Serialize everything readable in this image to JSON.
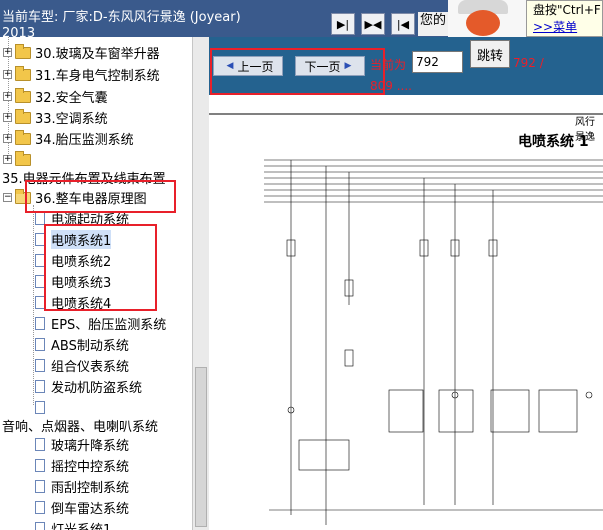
{
  "header": {
    "title_line1": "当前车型:   厂家:D-东风风行景逸 (Joyear)",
    "title_line2": "2013",
    "toolbar_text": "您的",
    "help_line1": "盘按\"Ctrl+F",
    "help_line2": ">>菜单"
  },
  "tree": {
    "items": [
      {
        "label": "30.玻璃及车窗举升器"
      },
      {
        "label": "31.车身电气控制系统"
      },
      {
        "label": "32.安全气囊"
      },
      {
        "label": "33.空调系统"
      },
      {
        "label": "34.胎压监测系统"
      },
      {
        "label": ""
      },
      {
        "label": "35.电器元件布置及线束布置"
      },
      {
        "label": "36.整车电器原理图"
      },
      {
        "label": "电源起动系统"
      },
      {
        "label": "电喷系统1"
      },
      {
        "label": "电喷系统2"
      },
      {
        "label": "电喷系统3"
      },
      {
        "label": "电喷系统4"
      },
      {
        "label": "EPS、胎压监测系统"
      },
      {
        "label": "ABS制动系统"
      },
      {
        "label": "组合仪表系统"
      },
      {
        "label": "发动机防盗系统"
      },
      {
        "label": ""
      },
      {
        "label": "音响、点烟器、电喇叭系统"
      },
      {
        "label": "玻璃升降系统"
      },
      {
        "label": "摇控中控系统"
      },
      {
        "label": "雨刮控制系统"
      },
      {
        "label": "倒车雷达系统"
      },
      {
        "label": "灯光系统1"
      }
    ]
  },
  "nav": {
    "prev_label": "上一页",
    "next_label": "下一页",
    "current_label": "当前为",
    "page_value": "792",
    "jump_label": "跳转",
    "total": "792 /",
    "total2": "809 ...."
  },
  "document": {
    "header": "风行景逸",
    "title": "电喷系统 1"
  }
}
